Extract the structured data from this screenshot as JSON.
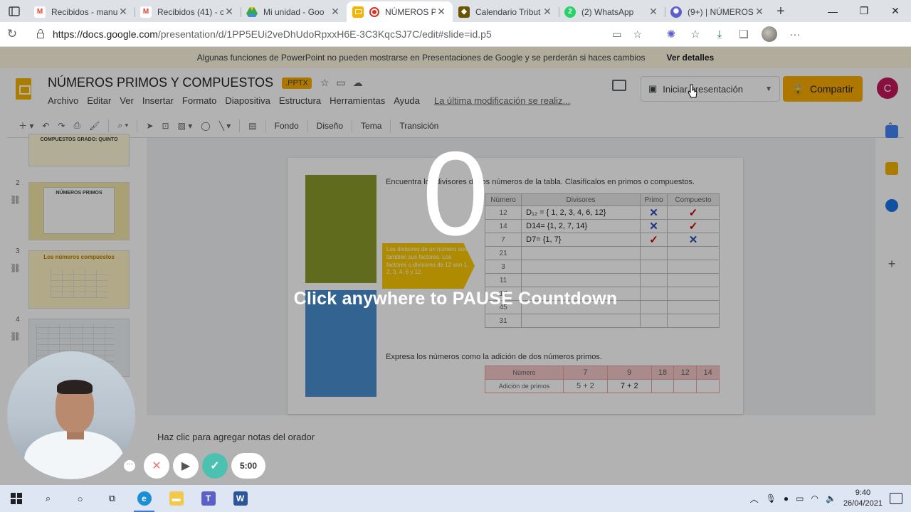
{
  "browser": {
    "tabs": [
      {
        "title": "Recibidos - manu",
        "icon": "gmail-icon",
        "color": "#ea4335",
        "active": false
      },
      {
        "title": "Recibidos (41) - c",
        "icon": "gmail-icon",
        "color": "#ea4335",
        "active": false
      },
      {
        "title": "Mi unidad - Goo",
        "icon": "drive-icon",
        "color": "#34a853",
        "active": false
      },
      {
        "title": "NÚMEROS P",
        "icon": "slides-icon",
        "color": "#f4b400",
        "active": true
      },
      {
        "title": "Calendario Tribut",
        "icon": "calendar-shield-icon",
        "color": "#8a6d00",
        "active": false
      },
      {
        "title": "(2) WhatsApp",
        "icon": "whatsapp-icon",
        "color": "#25d366",
        "active": false
      },
      {
        "title": "(9+) | NÚMEROS",
        "icon": "extension-icon",
        "color": "#5b5fc7",
        "active": false
      }
    ],
    "new_tab": "+",
    "url_host": "https://docs.google.com",
    "url_path": "/presentation/d/1PP5EUi2veDhUdoRpxxH6E-3C3KqcSJ7C/edit#slide=id.p5"
  },
  "docs": {
    "warning": "Algunas funciones de PowerPoint no pueden mostrarse en Presentaciones de Google y se perderán si haces cambios",
    "warning_link": "Ver detalles",
    "title": "NÚMEROS  PRIMOS Y  COMPUESTOS",
    "badge": ".PPTX",
    "menus": [
      "Archivo",
      "Editar",
      "Ver",
      "Insertar",
      "Formato",
      "Diapositiva",
      "Estructura",
      "Herramientas",
      "Ayuda"
    ],
    "last_modified": "La última modificación se realiz...",
    "present_label": "Iniciar presentación",
    "share_label": "Compartir",
    "user_initial": "C",
    "toolbar": {
      "fondo": "Fondo",
      "diseno": "Diseño",
      "tema": "Tema",
      "transicion": "Transición"
    },
    "speaker_notes": "Haz clic para agregar notas del orador",
    "thumbnails": [
      {
        "num": "",
        "title": "COMPUESTOS\nGRADO: QUINTO"
      },
      {
        "num": "2",
        "title": "NÚMEROS PRIMOS"
      },
      {
        "num": "3",
        "title": "Los números compuestos"
      },
      {
        "num": "4",
        "title": ""
      }
    ]
  },
  "slide": {
    "instruction": "Encuentra los divisores de los números de la tabla. Clasifícalos en primos o compuestos.",
    "note": "Los divisores de un número son también sus factores. Los factores o divisores de 12 son 1, 2, 3, 4, 6 y 12.",
    "table_headers": [
      "Número",
      "Divisores",
      "Primo",
      "Compuesto"
    ],
    "rows": [
      {
        "n": "12",
        "div": "D₁₂ = { 1, 2, 3, 4, 6, 12}",
        "primo": "✕",
        "comp": "✓"
      },
      {
        "n": "14",
        "div": "D14= {1, 2, 7, 14}",
        "primo": "✕",
        "comp": "✓"
      },
      {
        "n": "7",
        "div": "D7= {1, 7}",
        "primo": "✓",
        "comp": "✕"
      },
      {
        "n": "21",
        "div": "",
        "primo": "",
        "comp": ""
      },
      {
        "n": "3",
        "div": "",
        "primo": "",
        "comp": ""
      },
      {
        "n": "11",
        "div": "",
        "primo": "",
        "comp": ""
      },
      {
        "n": "17",
        "div": "",
        "primo": "",
        "comp": ""
      },
      {
        "n": "45",
        "div": "",
        "primo": "",
        "comp": ""
      },
      {
        "n": "31",
        "div": "",
        "primo": "",
        "comp": ""
      }
    ],
    "instruction2": "Expresa los números como la adición de dos números primos.",
    "table2_label1": "Número",
    "table2_label2": "Adición de primos",
    "table2_nums": [
      "7",
      "9",
      "18",
      "12",
      "14"
    ],
    "table2_sums": [
      "5 + 2",
      "7 + 2",
      "",
      "",
      ""
    ]
  },
  "overlay": {
    "countdown": "0",
    "message": "Click anywhere to PAUSE Countdown",
    "timer": "5:00",
    "more": "···"
  },
  "taskbar": {
    "time": "9:40",
    "date": "26/04/2021"
  },
  "colors": {
    "accent": "#f9ab00",
    "check": "#cc0000",
    "cross": "#2a4db8"
  }
}
